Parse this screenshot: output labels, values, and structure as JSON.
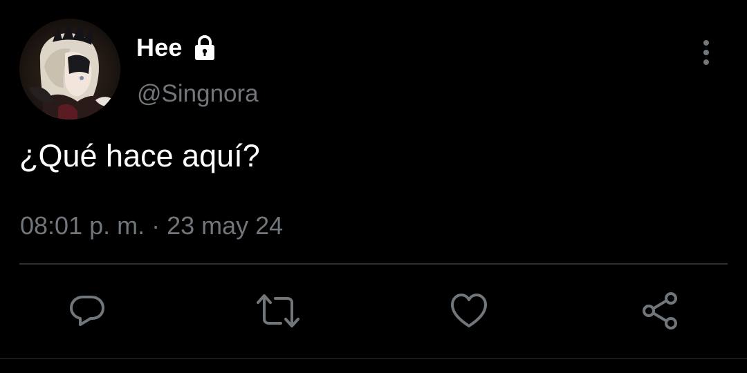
{
  "tweet": {
    "display_name": "Hee",
    "handle": "@Singnora",
    "text": "¿Qué hace aquí?",
    "timestamp": "08:01 p. m. · 23 may 24",
    "verified_lock": "lock-icon"
  },
  "icons": {
    "more": "more-vertical-icon",
    "reply": "reply-icon",
    "retweet": "retweet-icon",
    "like": "heart-icon",
    "share": "share-icon"
  },
  "colors": {
    "background": "#000000",
    "primary_text": "#ffffff",
    "secondary_text": "#71767b",
    "divider": "#2f3336"
  }
}
